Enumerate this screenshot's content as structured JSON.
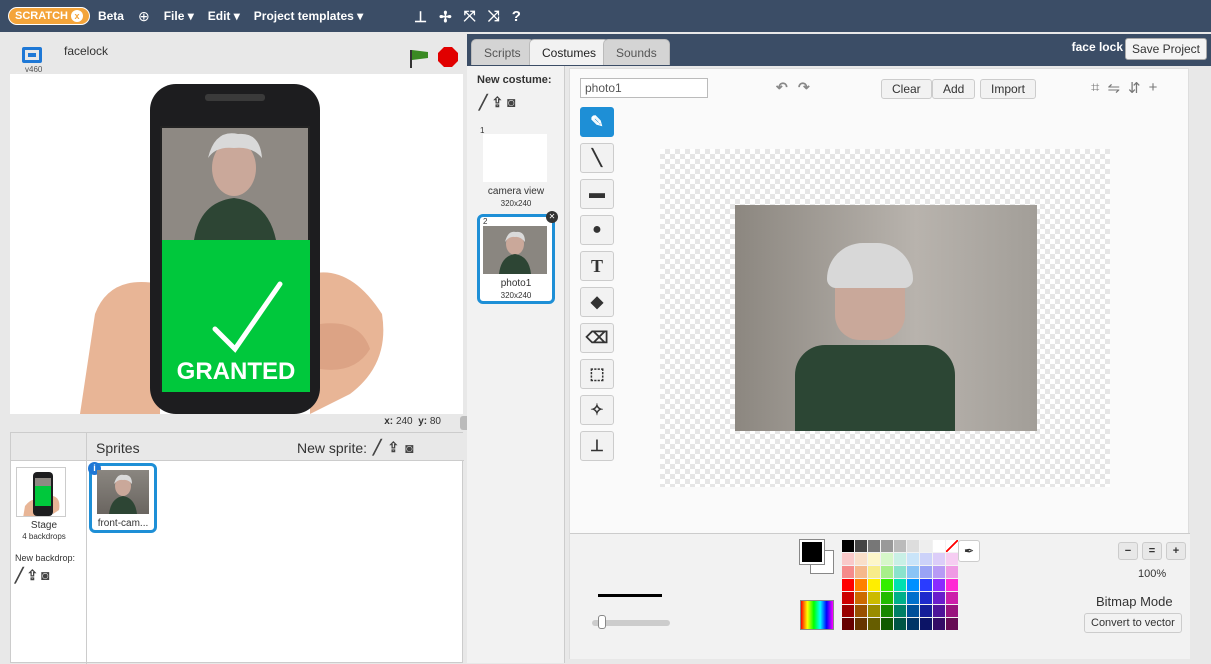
{
  "menubar": {
    "logo": "SCRATCH",
    "beta": "Beta",
    "file": "File ▾",
    "edit": "Edit ▾",
    "templates": "Project templates ▾"
  },
  "stage": {
    "version": "v460",
    "project_name": "facelock",
    "granted_text": "GRANTED",
    "coords_x_label": "x:",
    "coords_x": "240",
    "coords_y_label": "y:",
    "coords_y": "80"
  },
  "sprites": {
    "title": "Sprites",
    "new_sprite": "New sprite:",
    "stage_label": "Stage",
    "stage_backdrops": "4 backdrops",
    "new_backdrop": "New backdrop:",
    "items": [
      {
        "name": "front-cam..."
      }
    ]
  },
  "tabs": {
    "scripts": "Scripts",
    "costumes": "Costumes",
    "sounds": "Sounds",
    "project_title": "face lock",
    "save_project": "Save Project"
  },
  "costumes": {
    "new_costume": "New costume:",
    "items": [
      {
        "num": "1",
        "name": "camera view",
        "size": "320x240"
      },
      {
        "num": "2",
        "name": "photo1",
        "size": "320x240"
      }
    ]
  },
  "editor": {
    "costume_name": "photo1",
    "clear": "Clear",
    "add": "Add",
    "import": "Import",
    "zoom": "100%",
    "mode": "Bitmap Mode",
    "convert": "Convert to vector"
  },
  "colors": {
    "accent": "#1e8fd6",
    "topbar": "#3b4d66",
    "granted_green": "#00c83c"
  }
}
